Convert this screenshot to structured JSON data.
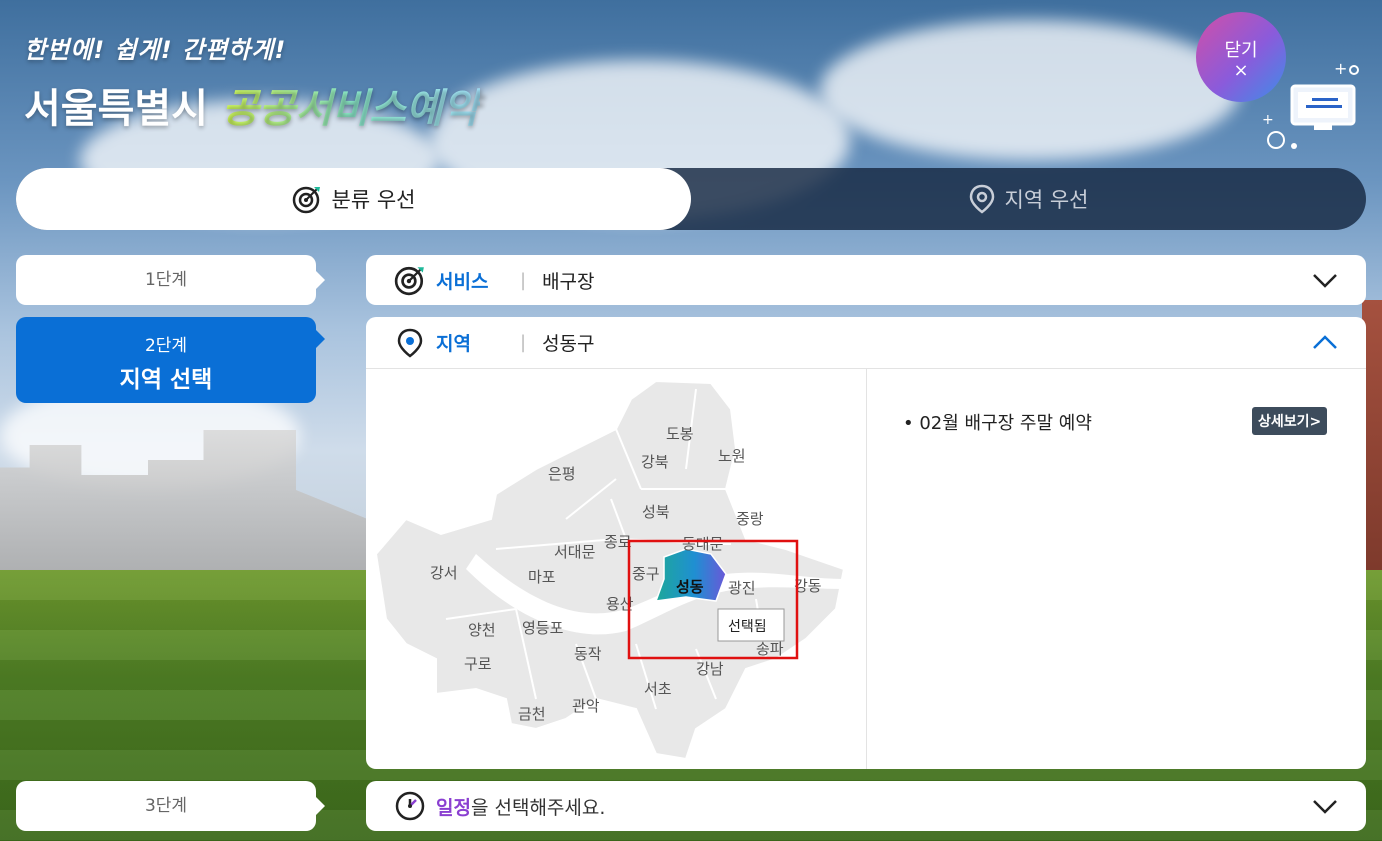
{
  "header": {
    "slogan_top": "한번에! 쉽게! 간편하게!",
    "title_main": "서울특별시 ",
    "title_accent": "공공서비스예약",
    "close_label": "닫기",
    "close_symbol": "×"
  },
  "tabs": {
    "category_first": "분류 우선",
    "region_first": "지역 우선",
    "active": "category_first"
  },
  "steps": {
    "step1": "1단계",
    "step2_number": "2단계",
    "step2_title": "지역 선택",
    "step3": "3단계"
  },
  "service_row": {
    "label": "서비스",
    "value": "배구장"
  },
  "region_row": {
    "label": "지역",
    "value": "성동구"
  },
  "schedule_row": {
    "label_highlight": "일정",
    "label_rest": "을 선택해주세요."
  },
  "map": {
    "selected_tooltip": "선택됨",
    "districts": [
      "도봉",
      "노원",
      "강북",
      "은평",
      "성북",
      "중랑",
      "종로",
      "동대문",
      "서대문",
      "마포",
      "중구",
      "성동",
      "광진",
      "강동",
      "강서",
      "용산",
      "양천",
      "영등포",
      "동작",
      "송파",
      "구로",
      "강남",
      "서초",
      "금천",
      "관악"
    ],
    "selected": "성동"
  },
  "detail": {
    "notice": "02월 배구장 주말 예약",
    "detail_button": "상세보기>"
  },
  "colors": {
    "accent_blue": "#0a6fd6",
    "schedule_purple": "#8a3fd1",
    "selection_red": "#e01010",
    "tab_dark": "#162842"
  }
}
